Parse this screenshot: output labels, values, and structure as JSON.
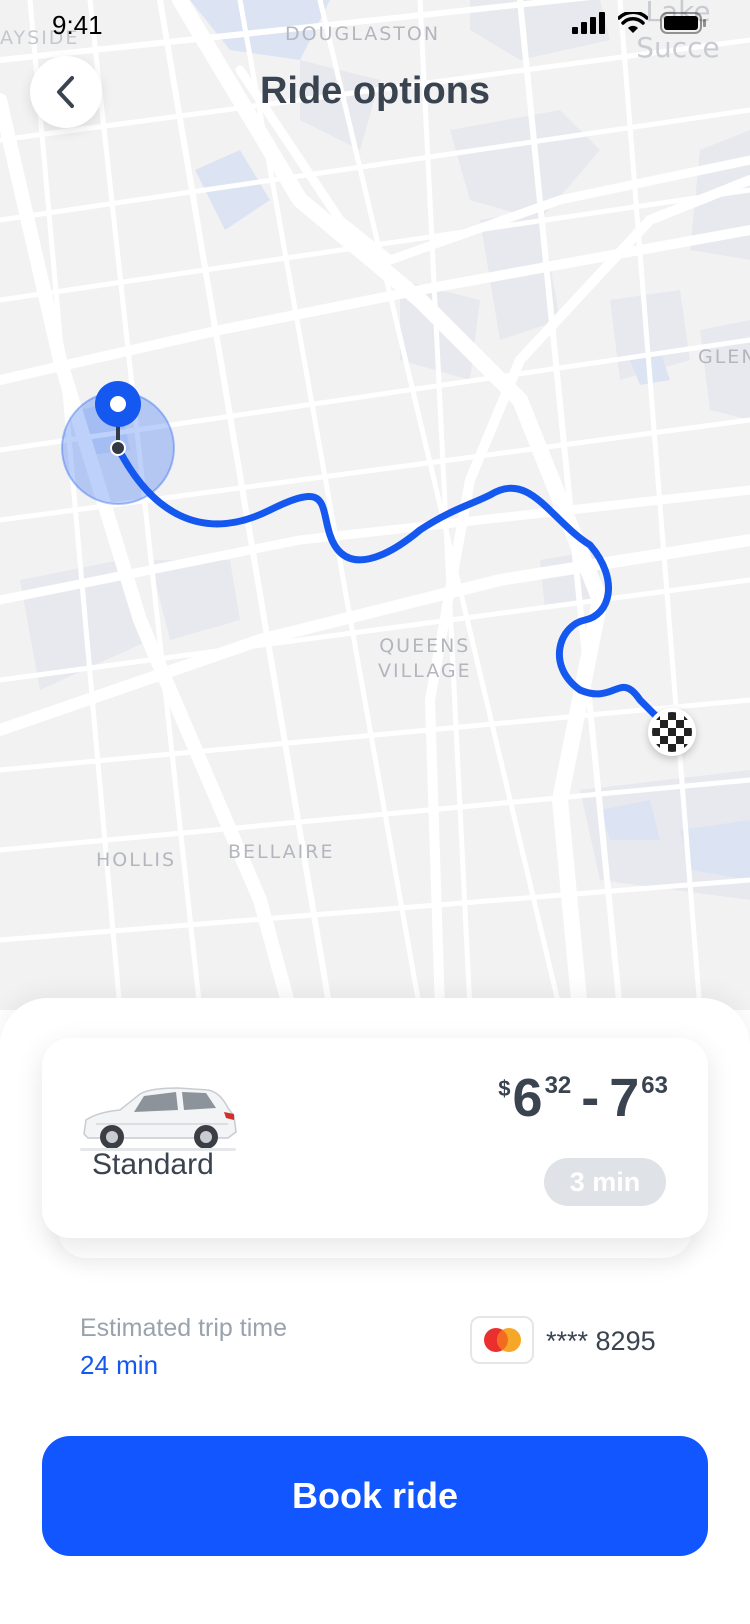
{
  "status_bar": {
    "time": "9:41"
  },
  "header": {
    "title": "Ride options"
  },
  "map": {
    "labels": {
      "douglaston": "DOUGLASTON",
      "bayside": "AYSIDE",
      "lake_success": "Lake Succe",
      "glen": "GLEN",
      "queens_village": "QUEENS\nVILLAGE",
      "hollis": "HOLLIS",
      "bellaire": "BELLAIRE"
    },
    "route_color": "#1558f0"
  },
  "ride": {
    "name": "Standard",
    "price": {
      "currency": "$",
      "low_whole": "6",
      "low_cents": "32",
      "separator": "-",
      "high_whole": "7",
      "high_cents": "63"
    },
    "eta": "3 min"
  },
  "trip": {
    "label": "Estimated trip time",
    "value": "24 min"
  },
  "payment": {
    "card_masked": "**** 8295",
    "brand_icon": "mastercard-icon"
  },
  "actions": {
    "book_label": "Book ride"
  },
  "colors": {
    "accent": "#1156ff",
    "text": "#3a4350",
    "muted": "#9aa3ad"
  }
}
